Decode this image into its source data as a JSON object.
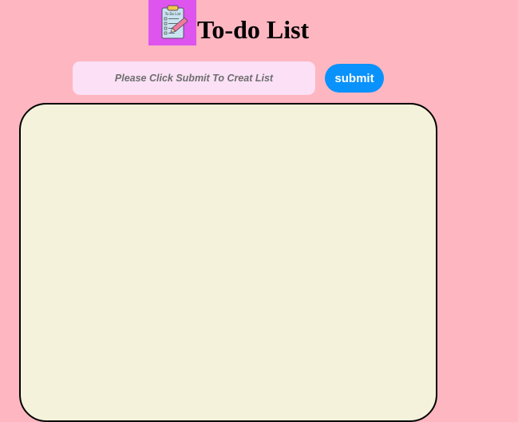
{
  "header": {
    "logo_icon": "clipboard-checklist-icon",
    "logo_text": "To-do List",
    "logo_bg": "#de54ee",
    "title": "To-do List"
  },
  "form": {
    "input_value": "",
    "input_placeholder": "Please Click Submit To Creat List",
    "submit_label": "submit",
    "submit_color": "#0992fb"
  },
  "list": {
    "items": [],
    "background": "#f4f2db"
  },
  "page": {
    "background": "#feb6c1"
  }
}
